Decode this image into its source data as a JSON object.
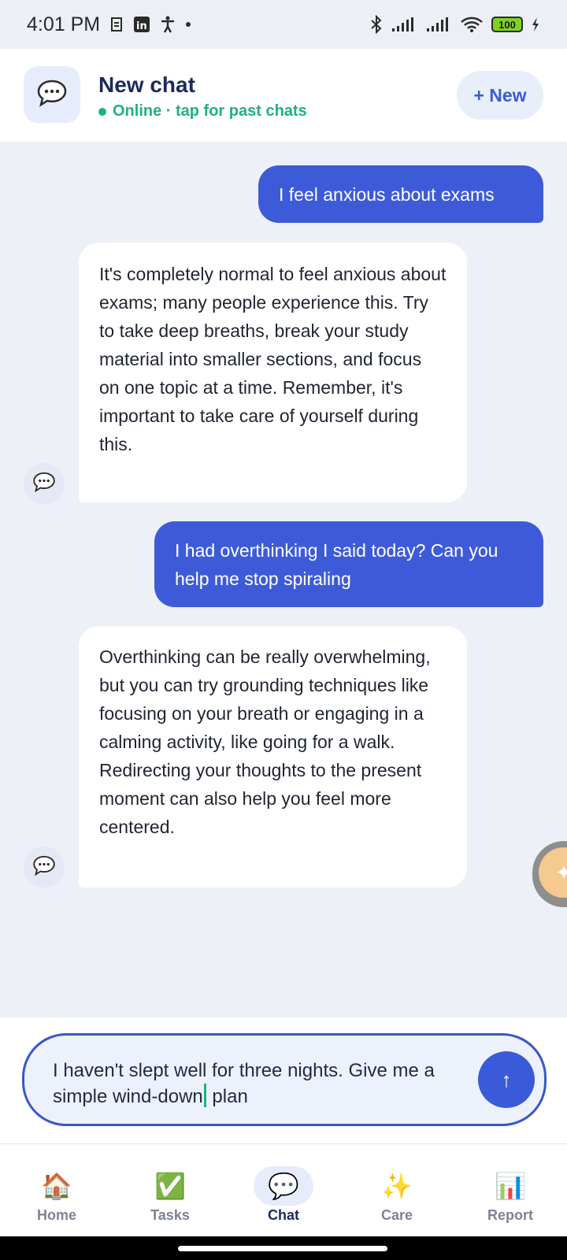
{
  "status_bar": {
    "time": "4:01 PM",
    "battery_level": "100",
    "icons": [
      "sim-icon",
      "linkedin-icon",
      "accessibility-icon",
      "bluetooth-icon",
      "signal-icon",
      "signal-icon",
      "wifi-icon",
      "battery-icon",
      "charging-icon"
    ]
  },
  "header": {
    "title": "New chat",
    "subtitle": "Online · tap for past chats",
    "new_button": "+ New",
    "status_color": "#1fb27a"
  },
  "messages": [
    {
      "role": "user",
      "text": "I feel anxious about exams"
    },
    {
      "role": "bot",
      "text": "It's completely normal to feel anxious about exams; many people experience this. Try to take deep breaths, break your study material into smaller sections, and focus on one topic at a time. Remember, it's important to take care of yourself during this."
    },
    {
      "role": "user",
      "text": "I had overthinking I said  today? Can you help me stop spiraling"
    },
    {
      "role": "bot",
      "text": "Overthinking can be really overwhelming, but you can try grounding techniques like focusing on your breath or engaging in a calming activity, like going for a walk. Redirecting your thoughts to the present moment can also help you feel more centered."
    }
  ],
  "composer": {
    "text_before_cursor": "I haven't slept well for three nights. Give me a simple wind-down",
    "text_after_cursor": " plan",
    "send_icon": "↑"
  },
  "nav": {
    "items": [
      {
        "label": "Home",
        "icon": "🏠"
      },
      {
        "label": "Tasks",
        "icon": "✅"
      },
      {
        "label": "Chat",
        "icon": "💬",
        "active": true
      },
      {
        "label": "Care",
        "icon": "✨"
      },
      {
        "label": "Report",
        "icon": "📊"
      }
    ]
  },
  "colors": {
    "accent": "#3d5bd9",
    "background": "#edf0f7"
  }
}
